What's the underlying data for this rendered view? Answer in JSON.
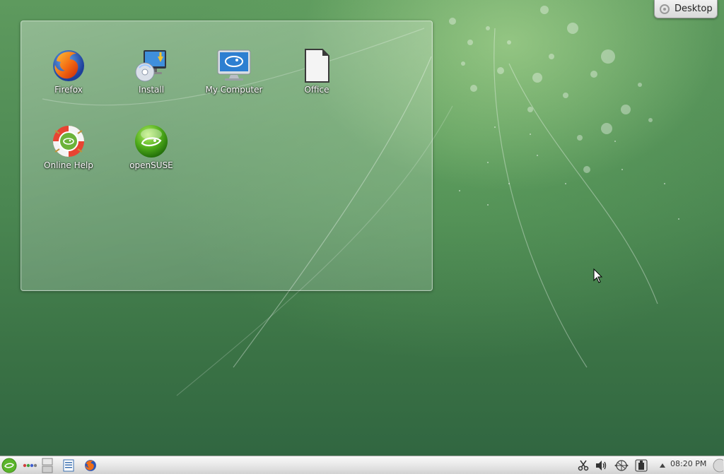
{
  "desktop": {
    "toolbox_label": "Desktop",
    "icons": [
      {
        "label": "Firefox",
        "icon": "firefox-icon"
      },
      {
        "label": "Install",
        "icon": "install-icon"
      },
      {
        "label": "My Computer",
        "icon": "computer-icon"
      },
      {
        "label": "Office",
        "icon": "office-document-icon"
      },
      {
        "label": "Online Help",
        "icon": "help-lifebuoy-icon"
      },
      {
        "label": "openSUSE",
        "icon": "opensuse-icon"
      }
    ]
  },
  "taskbar": {
    "launcher_icon": "opensuse-kickoff-icon",
    "pager_icon": "activities-icon",
    "clock": "08:20 PM",
    "tray_icons": [
      "scissors-icon",
      "volume-icon",
      "network-icon",
      "device-notifier-icon",
      "show-tray-arrow-icon"
    ]
  },
  "colors": {
    "wallpaper_top": "#5e9a5e",
    "wallpaper_bottom": "#2f6440",
    "opensuse_green": "#73ba25"
  }
}
